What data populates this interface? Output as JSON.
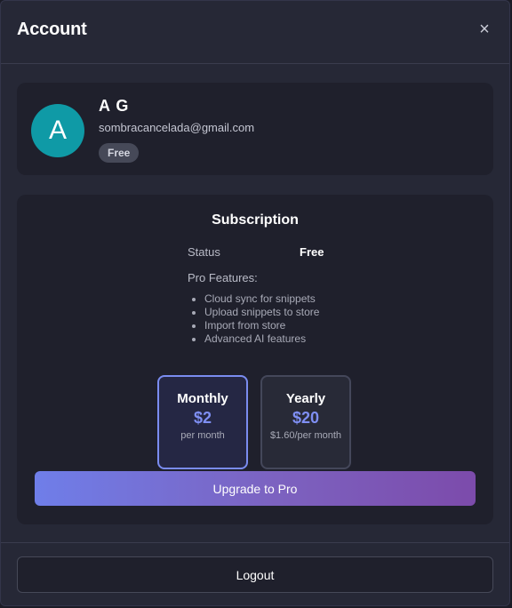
{
  "header": {
    "title": "Account",
    "close_glyph": "×"
  },
  "profile": {
    "avatar_letter": "A",
    "avatar_color": "#0f9aa6",
    "name": "A G",
    "email": "sombracancelada@gmail.com",
    "plan_badge": "Free"
  },
  "subscription": {
    "title": "Subscription",
    "status_label": "Status",
    "status_value": "Free",
    "features_label": "Pro Features:",
    "features": [
      "Cloud sync for snippets",
      "Upload snippets to store",
      "Import from store",
      "Advanced AI features"
    ],
    "plans": [
      {
        "name": "Monthly",
        "price": "$2",
        "detail": "per month",
        "selected": true
      },
      {
        "name": "Yearly",
        "price": "$20",
        "detail": "$1.60/per month",
        "selected": false
      }
    ],
    "upgrade_label": "Upgrade to Pro"
  },
  "footer": {
    "logout_label": "Logout"
  },
  "colors": {
    "accent": "#7f8ff3",
    "gradient_start": "#6f7ee9",
    "gradient_end": "#7c4bab",
    "background": "#262836",
    "card": "#1f202c"
  },
  "icons": {
    "close": "close-icon"
  }
}
